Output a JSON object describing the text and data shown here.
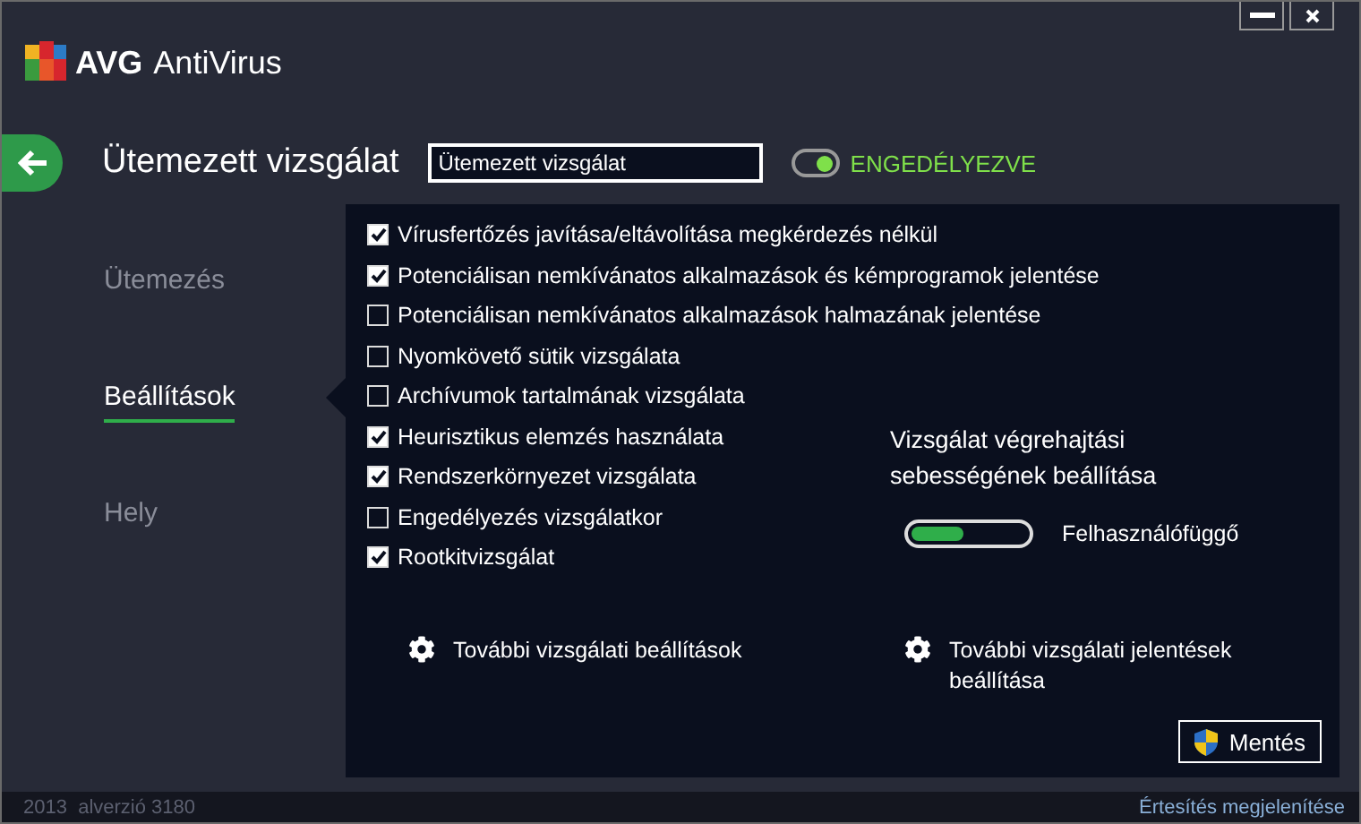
{
  "app": {
    "brand": "AVG",
    "product": "AntiVirus"
  },
  "page": {
    "title": "Ütemezett vizsgálat",
    "name_field": {
      "value": "Ütemezett vizsgálat"
    },
    "enabled": {
      "on": true,
      "label": "ENGEDÉLYEZVE"
    }
  },
  "sidebar": {
    "items": [
      {
        "label": "Ütemezés",
        "selected": false
      },
      {
        "label": "Beállítások",
        "selected": true
      },
      {
        "label": "Hely",
        "selected": false
      }
    ]
  },
  "options": [
    {
      "label": "Vírusfertőzés javítása/eltávolítása megkérdezés nélkül",
      "checked": true
    },
    {
      "label": "Potenciálisan nemkívánatos alkalmazások és kémprogramok jelentése",
      "checked": true
    },
    {
      "label": "Potenciálisan nemkívánatos alkalmazások halmazának jelentése",
      "checked": false
    },
    {
      "label": "Nyomkövető sütik vizsgálata",
      "checked": false
    },
    {
      "label": "Archívumok tartalmának vizsgálata",
      "checked": false
    },
    {
      "label": "Heurisztikus elemzés használata",
      "checked": true
    },
    {
      "label": "Rendszerkörnyezet vizsgálata",
      "checked": true
    },
    {
      "label": "Engedélyezés vizsgálatkor",
      "checked": false
    },
    {
      "label": "Rootkitvizsgálat",
      "checked": true
    }
  ],
  "speed": {
    "title": "Vizsgálat végrehajtási sebességének beállítása",
    "level": 0.45,
    "reading": "Felhasználófüggő"
  },
  "links": [
    "További vizsgálati beállítások",
    "További vizsgálati jelentések beállítása"
  ],
  "save_button": "Mentés",
  "status_bar": {
    "version": "2013  alverzió 3180",
    "notification_link": "Értesítés megjelenítése"
  }
}
